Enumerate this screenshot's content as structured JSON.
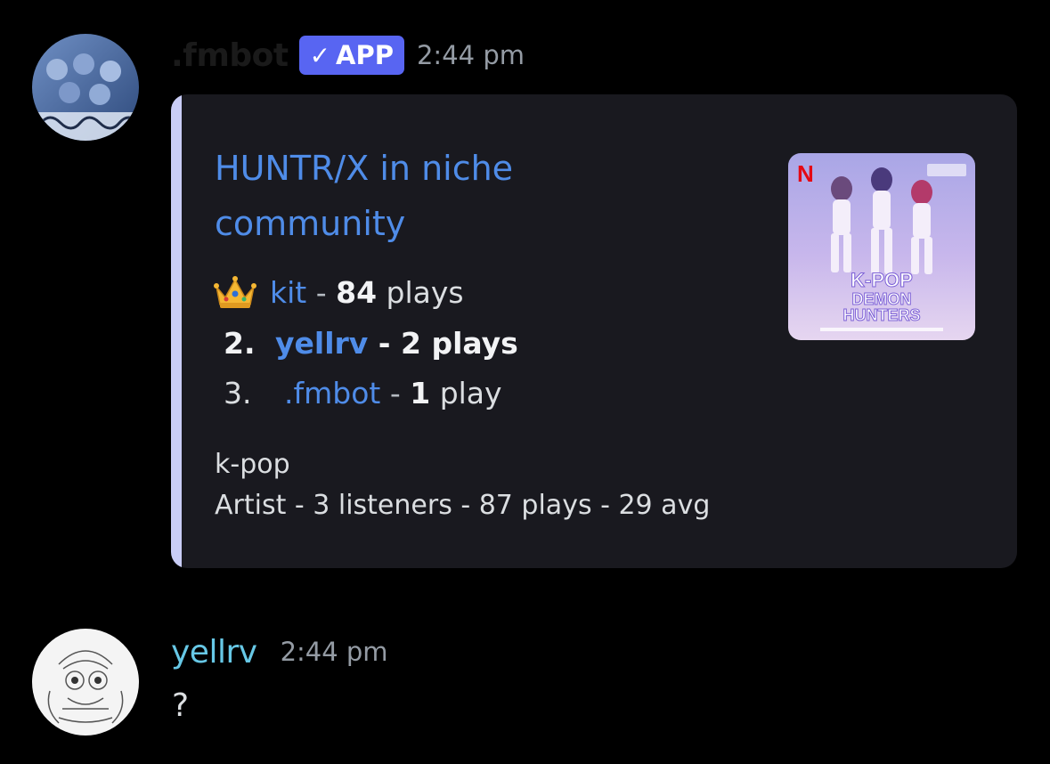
{
  "message1": {
    "username": ".fmbot",
    "badge": {
      "check": "✓",
      "label": "APP"
    },
    "timestamp": "2:44 pm",
    "avatar_icon": "album-art-avatar",
    "embed": {
      "title": "HUNTR/X in niche community",
      "accent_color": "#c9cdf6",
      "thumbnail_icon": "kpop-demon-hunters-album-art",
      "ranks": [
        {
          "marker": "👑",
          "user": "kit",
          "sep": " - ",
          "count": "84",
          "unit": " plays"
        },
        {
          "marker": "2.",
          "user": "yellrv",
          "sep": " - ",
          "count": "2",
          "unit": " plays"
        },
        {
          "marker": "3.",
          "user": ".fmbot",
          "sep": " - ",
          "count": "1",
          "unit": " play"
        }
      ],
      "genre": "k-pop",
      "stats": "Artist - 3 listeners - 87 plays - 29 avg"
    }
  },
  "message2": {
    "username": "yellrv",
    "timestamp": "2:44 pm",
    "avatar_icon": "sketch-avatar",
    "text": "?"
  }
}
